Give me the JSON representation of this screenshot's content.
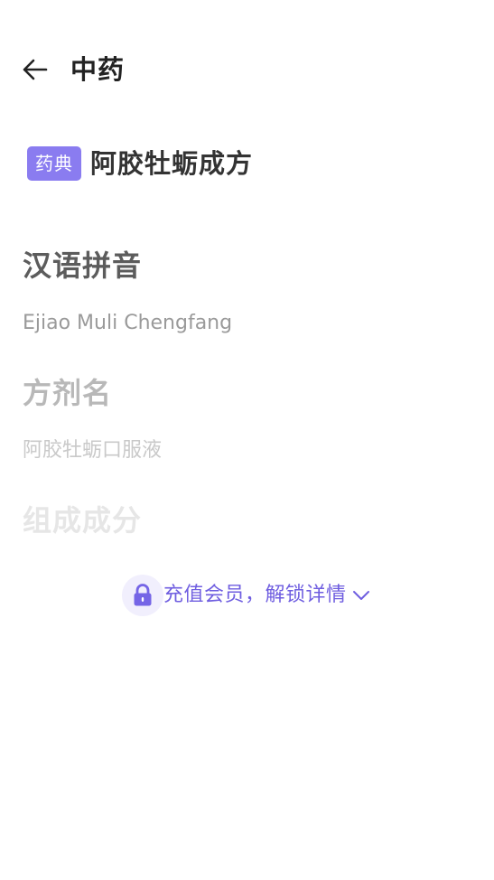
{
  "header": {
    "back_icon": "arrow-left-icon",
    "title": "中药"
  },
  "entry": {
    "badge": "药典",
    "name": "阿胶牡蛎成方"
  },
  "sections": [
    {
      "heading": "汉语拼音",
      "value": "Ejiao Muli Chengfang"
    },
    {
      "heading": "方剂名",
      "value": "阿胶牡蛎口服液"
    },
    {
      "heading": "组成成分"
    }
  ],
  "unlock": {
    "lock_icon": "lock-icon",
    "label": "充值会员，解锁详情",
    "chevron_icon": "chevron-down-icon"
  },
  "colors": {
    "accent": "#6f5ee0",
    "badge_bg": "#8a7cf0",
    "lock_bg": "#f1effd"
  }
}
